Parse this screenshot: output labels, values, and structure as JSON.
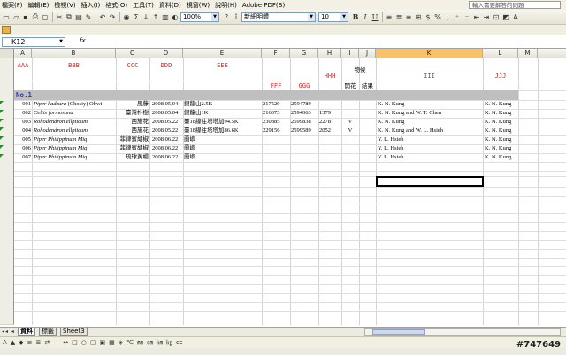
{
  "menu": {
    "items": [
      "檔案(F)",
      "編輯(E)",
      "檢視(V)",
      "插入(I)",
      "格式(O)",
      "工具(T)",
      "資料(D)",
      "視窗(W)",
      "說明(H)",
      "Adobe PDF(B)"
    ],
    "help_placeholder": "輸入需要解答的問題"
  },
  "toolbar": {
    "zoom": "100%",
    "font_name": "新細明體",
    "font_size": "10",
    "bold": "B",
    "italic": "I",
    "underline": "U",
    "currency": "$",
    "percent": "%"
  },
  "formula_bar": {
    "name_box": "K12",
    "fx": "fx"
  },
  "columns": [
    "A",
    "B",
    "C",
    "D",
    "E",
    "F",
    "G",
    "H",
    "I",
    "J",
    "K",
    "L",
    "M"
  ],
  "selected_column": "K",
  "header": {
    "aaa": "AAA",
    "bbb": "BBB",
    "ccc": "CCC",
    "ddd": "DDD",
    "eee": "EEE",
    "fff": "FFF",
    "ggg": "GGG",
    "hhh": "HHH",
    "wuhou": "物候",
    "kaihua": "開花",
    "jieguo": "結果",
    "iii": "III",
    "jjj": "JJJ"
  },
  "section_label": "No.1",
  "rows": [
    {
      "a": "001",
      "b": "Piper kadzura",
      "b2": "(Chosiy) Ohwi",
      "c": "風藤",
      "d": "2008.05.04",
      "e": "銀龍山2.5K",
      "f": "217529",
      "g": "2594789",
      "h": "",
      "i": "",
      "k": "K. N. Kung",
      "l": "K. N. Kung"
    },
    {
      "a": "002",
      "b": "Celtis formosana",
      "b2": "",
      "c": "臺灣朴樹",
      "d": "2008.05.04",
      "e": "銀龍山1K",
      "f": "216373",
      "g": "2594063",
      "h": "1379",
      "i": "",
      "k": "K. N. Kung and W. T. Chen",
      "l": "K. N. Kung"
    },
    {
      "a": "003",
      "b": "Rohodendron ellpticum",
      "b2": "",
      "c": "西施花",
      "d": "2008.05.22",
      "e": "臺18線往塔塔加94.5K",
      "f": "230885",
      "g": "2599838",
      "h": "2278",
      "i": "V",
      "k": "K. N. Kung",
      "l": "K. N. Kung"
    },
    {
      "a": "004",
      "b": "Rohodendron ellpticum",
      "b2": "",
      "c": "西施花",
      "d": "2008.05.22",
      "e": "臺18線往塔塔加86.6K",
      "f": "229156",
      "g": "2599589",
      "h": "2052",
      "i": "V",
      "k": "K. N. Kung and W. L. Hsieh",
      "l": "K. N. Kung"
    },
    {
      "a": "005",
      "b": "Piper Philippinum Miq",
      "b2": "",
      "c": "菲律賓胡椒",
      "d": "2008.06.22",
      "e": "蘭嶼",
      "f": "",
      "g": "",
      "h": "",
      "i": "",
      "k": "Y. L. Hsieh",
      "l": "K. N. Kung"
    },
    {
      "a": "006",
      "b": "Piper Philippinum Miq",
      "b2": "",
      "c": "菲律賓胡椒",
      "d": "2008.06.22",
      "e": "蘭嶼",
      "f": "",
      "g": "",
      "h": "",
      "i": "",
      "k": "Y. L. Hsieh",
      "l": "K. N. Kung"
    },
    {
      "a": "007",
      "b": "Piper Philippinum Miq",
      "b2": "",
      "c": "琉球黃楊",
      "d": "2008.06.22",
      "e": "蘭嶼",
      "f": "",
      "g": "",
      "h": "",
      "i": "",
      "k": "Y. L. Hsieh",
      "l": "K. N. Kung"
    }
  ],
  "sheet_tabs": [
    "資料",
    "標籤",
    "Sheet3"
  ],
  "draw_toolbar": [
    "A",
    "▲",
    "◆",
    "≡",
    "≣",
    "⇄",
    "—",
    "↔",
    "□",
    "○",
    "▢",
    "▣",
    "▦",
    "◈",
    "℃",
    "㎜",
    "㎝",
    "㎞",
    "㎏",
    "cc"
  ],
  "watermark": "#747649"
}
